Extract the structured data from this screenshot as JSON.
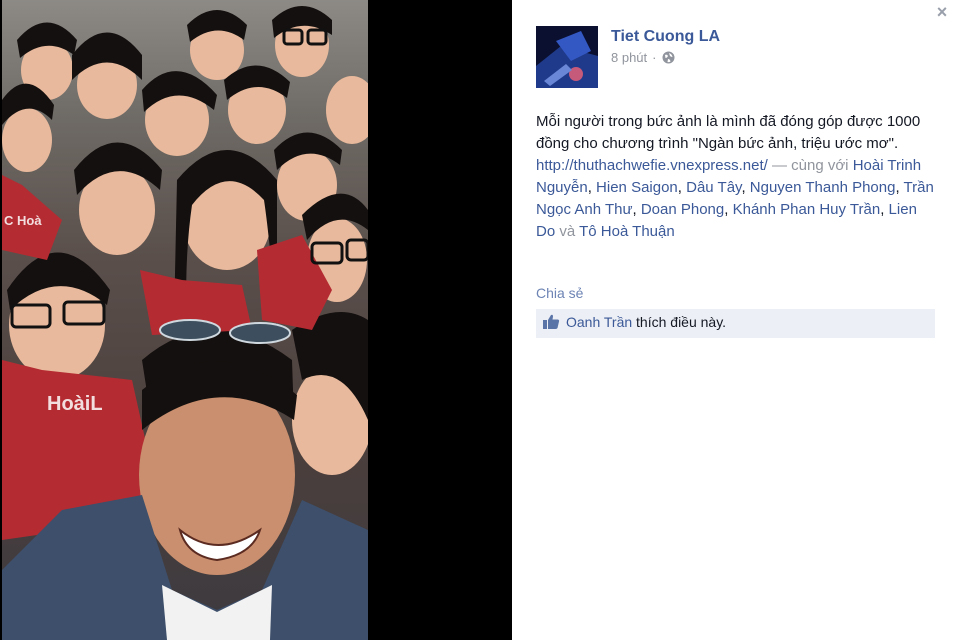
{
  "viewer": {
    "close_label": "×"
  },
  "post": {
    "owner": "Tiet Cuong LA",
    "time": "8 phút",
    "separator": "·",
    "privacy_icon": "globe-icon",
    "caption_line": "Mỗi người trong bức ảnh là mình đã đóng góp được 1000 đồng cho chương trình \"Ngàn bức ảnh, triệu ước mơ\".",
    "link": "http://thuthachwefie.vnexpress.net/",
    "with_prefix": " — cùng với ",
    "tags": [
      "Hoài Trinh Nguyễn",
      "Hien Saigon",
      "Dâu Tây",
      "Nguyen Thanh Phong",
      "Trần Ngọc Anh Thư",
      "Doan Phong",
      "Khánh Phan Huy Trần",
      "Lien Do"
    ],
    "tag_sep": ", ",
    "and_word": " và ",
    "last_tag": "Tô Hoà Thuận"
  },
  "actions": {
    "share_label": "Chia sẻ"
  },
  "likes": {
    "icon": "thumbs-up-icon",
    "name": "Oanh Trần",
    "suffix": " thích điều này."
  },
  "photo_text": {
    "shirt_text": "HoàiL",
    "shirt_text_2": "C Hoà"
  },
  "colors": {
    "link": "#3b5998",
    "text": "#141823",
    "muted": "#90949c",
    "like_bar": "#eceff5"
  }
}
